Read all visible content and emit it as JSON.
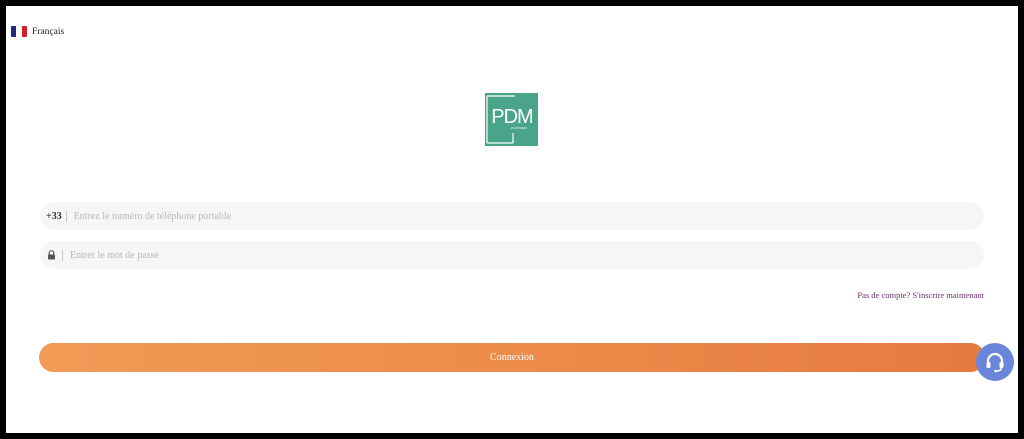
{
  "language": {
    "label": "Français",
    "flag_colors": [
      "#1f2a7a",
      "#ffffff",
      "#d0202e"
    ]
  },
  "logo": {
    "text": "PDM",
    "subtext": "PLATFORM",
    "bg_color": "#4aa489"
  },
  "form": {
    "phone": {
      "prefix": "+33",
      "placeholder": "Entrez le numéro de téléphone portable",
      "value": ""
    },
    "password": {
      "icon": "lock-icon",
      "placeholder": "Entrer le mot de passe",
      "value": ""
    }
  },
  "register_link": "Pas de compte? S'inscrire maintenant",
  "login_button": {
    "label": "Connexion",
    "gradient": [
      "#f19a56",
      "#e67a40"
    ]
  },
  "support_button": {
    "icon": "headset-icon",
    "color": "#6b86d9"
  }
}
